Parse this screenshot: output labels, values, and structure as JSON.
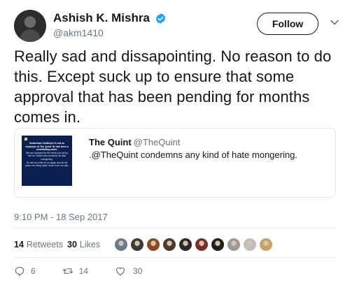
{
  "author": {
    "display_name": "Ashish K. Mishra",
    "handle": "@akm1410",
    "verified_icon": "verified-badge-icon",
    "avatar_icon": "avatar"
  },
  "header": {
    "follow_label": "Follow",
    "menu_icon": "chevron-down-icon"
  },
  "tweet": {
    "text": "Really sad and dissapointing. No reason to do this. Except suck up to ensure that some approval that has been pending for months comes in."
  },
  "quote": {
    "author_name": "The Quint",
    "author_handle": "@TheQuint",
    "text": ".@TheQuint condemns any kind of hate mongering.",
    "thumb_lines": [
      "Sudarshan Chatterjee is not an employee of The Quint. He has been a contributing writer.",
      "We are shocked by the views put out by him on Twitter and condemn all hate mongering.",
      "He will not write for us again and all his posts are being taken down from our site."
    ]
  },
  "meta": {
    "timestamp": "9:10 PM - 18 Sep 2017"
  },
  "stats": {
    "retweets_count": "14",
    "retweets_label": "Retweets",
    "likes_count": "30",
    "likes_label": "Likes",
    "liker_colors": [
      "#6a7a8c",
      "#3b3b3b",
      "#8a4a2a",
      "#4b3a2e",
      "#2a2a2a",
      "#7a2e2e",
      "#1f1f1f",
      "#9a9a9a",
      "#bfbfbf",
      "#c7a06a"
    ]
  },
  "actions": {
    "reply_count": "6",
    "retweet_count": "14",
    "like_count": "30",
    "reply_icon": "reply-icon",
    "retweet_icon": "retweet-icon",
    "like_icon": "heart-icon"
  },
  "colors": {
    "text_primary": "#14171a",
    "text_secondary": "#657786",
    "verified_blue": "#1da1f2",
    "border": "#e1e8ed"
  }
}
